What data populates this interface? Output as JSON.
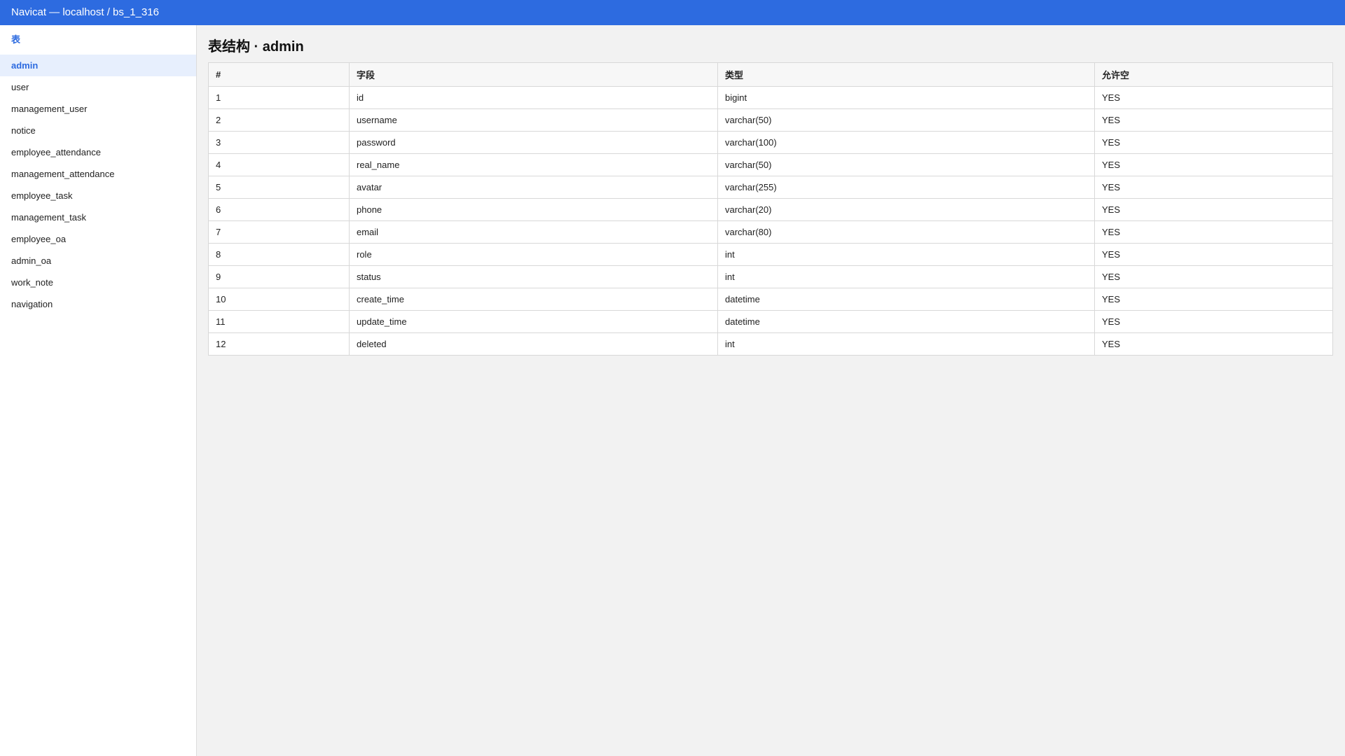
{
  "window": {
    "title": "Navicat — localhost / bs_1_316"
  },
  "sidebar": {
    "header": "表",
    "items": [
      {
        "label": "admin",
        "active": true
      },
      {
        "label": "user"
      },
      {
        "label": "management_user"
      },
      {
        "label": "notice"
      },
      {
        "label": "employee_attendance"
      },
      {
        "label": "management_attendance"
      },
      {
        "label": "employee_task"
      },
      {
        "label": "management_task"
      },
      {
        "label": "employee_oa"
      },
      {
        "label": "admin_oa"
      },
      {
        "label": "work_note"
      },
      {
        "label": "navigation"
      }
    ]
  },
  "main": {
    "title": "表结构 · admin",
    "columns": [
      "#",
      "字段",
      "类型",
      "允许空"
    ],
    "rows": [
      [
        "1",
        "id",
        "bigint",
        "YES"
      ],
      [
        "2",
        "username",
        "varchar(50)",
        "YES"
      ],
      [
        "3",
        "password",
        "varchar(100)",
        "YES"
      ],
      [
        "4",
        "real_name",
        "varchar(50)",
        "YES"
      ],
      [
        "5",
        "avatar",
        "varchar(255)",
        "YES"
      ],
      [
        "6",
        "phone",
        "varchar(20)",
        "YES"
      ],
      [
        "7",
        "email",
        "varchar(80)",
        "YES"
      ],
      [
        "8",
        "role",
        "int",
        "YES"
      ],
      [
        "9",
        "status",
        "int",
        "YES"
      ],
      [
        "10",
        "create_time",
        "datetime",
        "YES"
      ],
      [
        "11",
        "update_time",
        "datetime",
        "YES"
      ],
      [
        "12",
        "deleted",
        "int",
        "YES"
      ]
    ]
  },
  "colors": {
    "accent": "#2d6be0",
    "active_bg": "#e7effd"
  }
}
